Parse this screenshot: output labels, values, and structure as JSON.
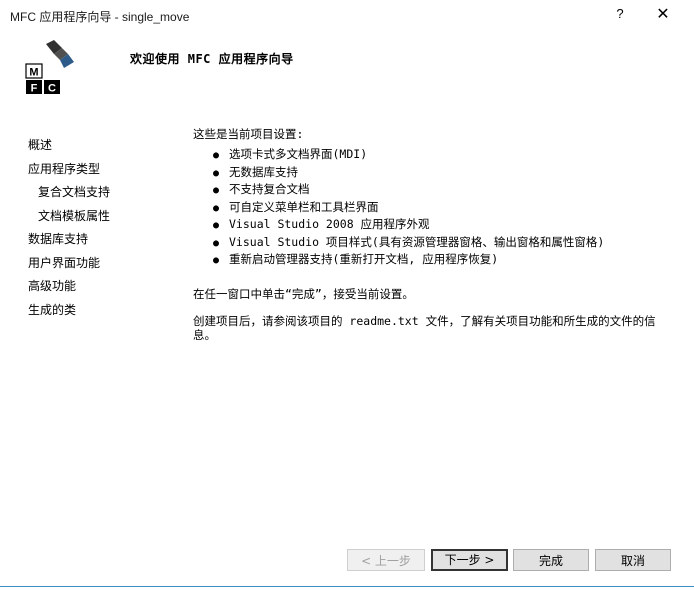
{
  "window": {
    "title": "MFC 应用程序向导 - single_move",
    "help_glyph": "?",
    "close_glyph": "✕"
  },
  "banner": {
    "welcome": "欢迎使用 MFC 应用程序向导",
    "logo_letters": [
      "M",
      "F",
      "C"
    ]
  },
  "nav": {
    "items": [
      {
        "label": "概述"
      },
      {
        "label": "应用程序类型"
      },
      {
        "label": "复合文档支持"
      },
      {
        "label": "文档模板属性"
      },
      {
        "label": "数据库支持"
      },
      {
        "label": "用户界面功能"
      },
      {
        "label": "高级功能"
      },
      {
        "label": "生成的类"
      }
    ]
  },
  "content": {
    "intro": "这些是当前项目设置:",
    "features": [
      "选项卡式多文档界面(MDI)",
      "无数据库支持",
      "不支持复合文档",
      "可自定义菜单栏和工具栏界面",
      "Visual Studio 2008 应用程序外观",
      "Visual Studio 项目样式(具有资源管理器窗格、输出窗格和属性窗格)",
      "重新启动管理器支持(重新打开文档, 应用程序恢复)"
    ],
    "finish_note": "在任一窗口中单击“完成”，接受当前设置。",
    "readme_note": "创建项目后，请参阅该项目的 readme.txt 文件，了解有关项目功能和所生成的文件的信息。"
  },
  "buttons": {
    "back": "< 上一步",
    "next": "下一步 >",
    "finish": "完成",
    "cancel": "取消"
  }
}
